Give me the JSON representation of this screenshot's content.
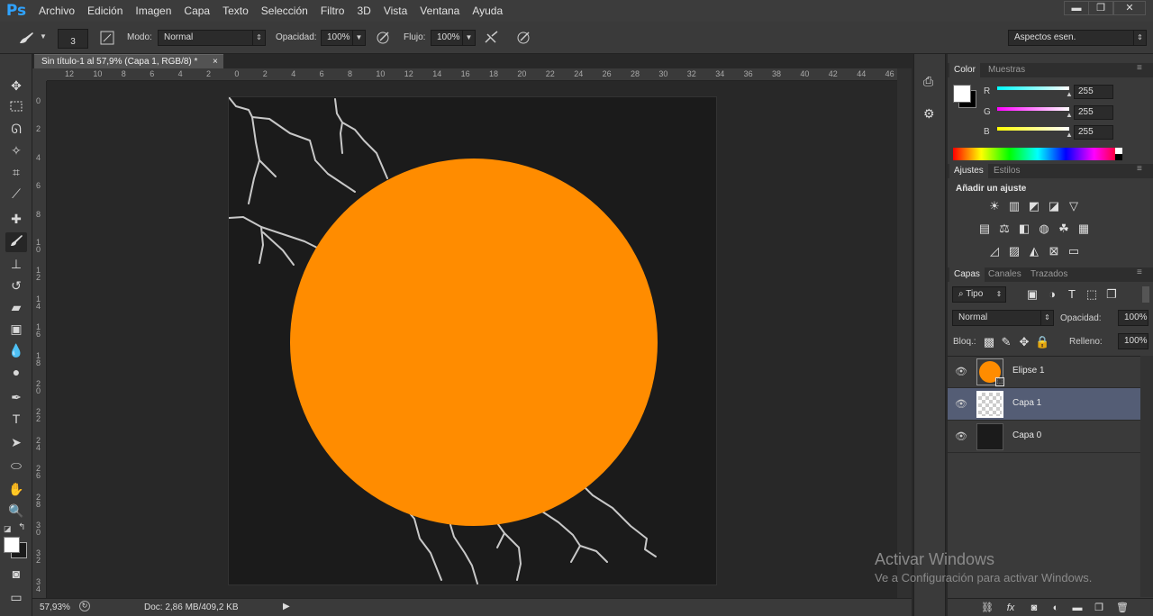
{
  "app": {
    "logo": "Ps"
  },
  "menu": [
    "Archivo",
    "Edición",
    "Imagen",
    "Capa",
    "Texto",
    "Selección",
    "Filtro",
    "3D",
    "Vista",
    "Ventana",
    "Ayuda"
  ],
  "window_buttons": {
    "minimize": "▬",
    "restore": "❐",
    "close": "✕"
  },
  "options": {
    "brush_size": "3",
    "mode_label": "Modo:",
    "mode_value": "Normal",
    "opacity_label": "Opacidad:",
    "opacity_value": "100%",
    "flow_label": "Flujo:",
    "flow_value": "100%",
    "workspace_value": "Aspectos esen."
  },
  "document": {
    "tab_title": "Sin título-1 al 57,9% (Capa 1, RGB/8) *",
    "tab_close": "×",
    "zoom": "57,93%",
    "doc_info": "Doc: 2,86 MB/409,2 KB",
    "circle_color": "#ff8c00",
    "background_color": "#1b1b1b",
    "stroke_color": "#c8c8c8"
  },
  "rulers": {
    "horizontal": [
      "12",
      "10",
      "8",
      "6",
      "4",
      "2",
      "0",
      "2",
      "4",
      "6",
      "8",
      "10",
      "12",
      "14",
      "16",
      "18",
      "20",
      "22",
      "24",
      "26",
      "28",
      "30",
      "32",
      "34",
      "36",
      "38",
      "40",
      "42",
      "44",
      "46"
    ],
    "vertical": [
      "0",
      "2",
      "4",
      "6",
      "8",
      "1 0",
      "1 2",
      "1 4",
      "1 6",
      "1 8",
      "2 0",
      "2 2",
      "2 4",
      "2 6",
      "2 8",
      "3 0",
      "3 2",
      "3 4"
    ]
  },
  "color_panel": {
    "tabs": [
      "Color",
      "Muestras"
    ],
    "channels": [
      {
        "label": "R",
        "value": "255",
        "color": "#00ffff"
      },
      {
        "label": "G",
        "value": "255",
        "color": "#ff00ff"
      },
      {
        "label": "B",
        "value": "255",
        "color": "#ffff00"
      }
    ]
  },
  "adjustments_panel": {
    "tabs": [
      "Ajustes",
      "Estilos"
    ],
    "heading": "Añadir un ajuste"
  },
  "layers_panel": {
    "tabs": [
      "Capas",
      "Canales",
      "Trazados"
    ],
    "filter_value": "Tipo",
    "blend_value": "Normal",
    "opacity_label": "Opacidad:",
    "opacity_value": "100%",
    "lock_label": "Bloq.:",
    "fill_label": "Relleno:",
    "fill_value": "100%",
    "layers": [
      {
        "name": "Elipse 1",
        "selected": false
      },
      {
        "name": "Capa 1",
        "selected": true
      },
      {
        "name": "Capa 0",
        "selected": false
      }
    ]
  },
  "watermark": {
    "title": "Activar Windows",
    "subtitle": "Ve a Configuración para activar Windows."
  }
}
